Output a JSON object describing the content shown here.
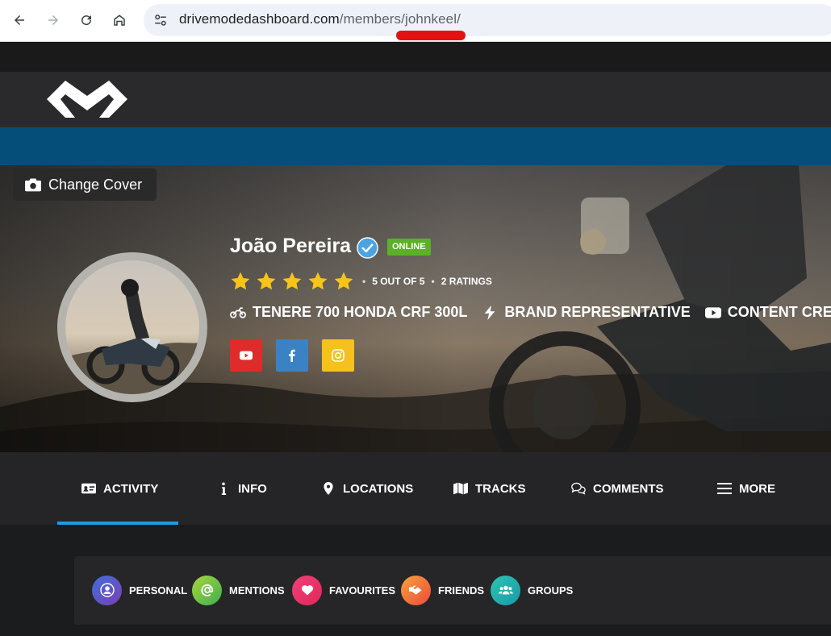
{
  "browser": {
    "url_domain": "drivemodedashboard.com",
    "url_path": "/members/johnkeel/"
  },
  "cover": {
    "change_cover_label": "Change Cover"
  },
  "profile": {
    "name": "João Pereira",
    "status": "ONLINE",
    "rating_stars": 5,
    "rating_text": "5 OUT OF 5",
    "ratings_count": "2 RATINGS",
    "tags": [
      {
        "icon": "motorcycle-icon",
        "label": "TENERE 700 HONDA CRF 300L"
      },
      {
        "icon": "bolt-icon",
        "label": "BRAND REPRESENTATIVE"
      },
      {
        "icon": "youtube-icon",
        "label": "CONTENT CREATOR"
      }
    ],
    "socials": [
      {
        "icon": "youtube-icon",
        "color": "#e02b2b"
      },
      {
        "icon": "facebook-icon",
        "color": "#3b82c4"
      },
      {
        "icon": "instagram-icon",
        "color": "#f5c21b"
      }
    ]
  },
  "nav": {
    "items": [
      {
        "icon": "id-card-icon",
        "label": "ACTIVITY",
        "active": true
      },
      {
        "icon": "info-icon",
        "label": "INFO"
      },
      {
        "icon": "map-pin-icon",
        "label": "LOCATIONS"
      },
      {
        "icon": "map-icon",
        "label": "TRACKS"
      },
      {
        "icon": "comments-icon",
        "label": "COMMENTS"
      },
      {
        "icon": "menu-icon",
        "label": "MORE"
      }
    ],
    "active_color": "#1e9be8"
  },
  "subnav": {
    "items": [
      {
        "icon": "user-icon",
        "label": "PERSONAL"
      },
      {
        "icon": "at-icon",
        "label": "MENTIONS"
      },
      {
        "icon": "heart-icon",
        "label": "FAVOURITES"
      },
      {
        "icon": "handshake-icon",
        "label": "FRIENDS"
      },
      {
        "icon": "group-icon",
        "label": "GROUPS"
      }
    ]
  }
}
